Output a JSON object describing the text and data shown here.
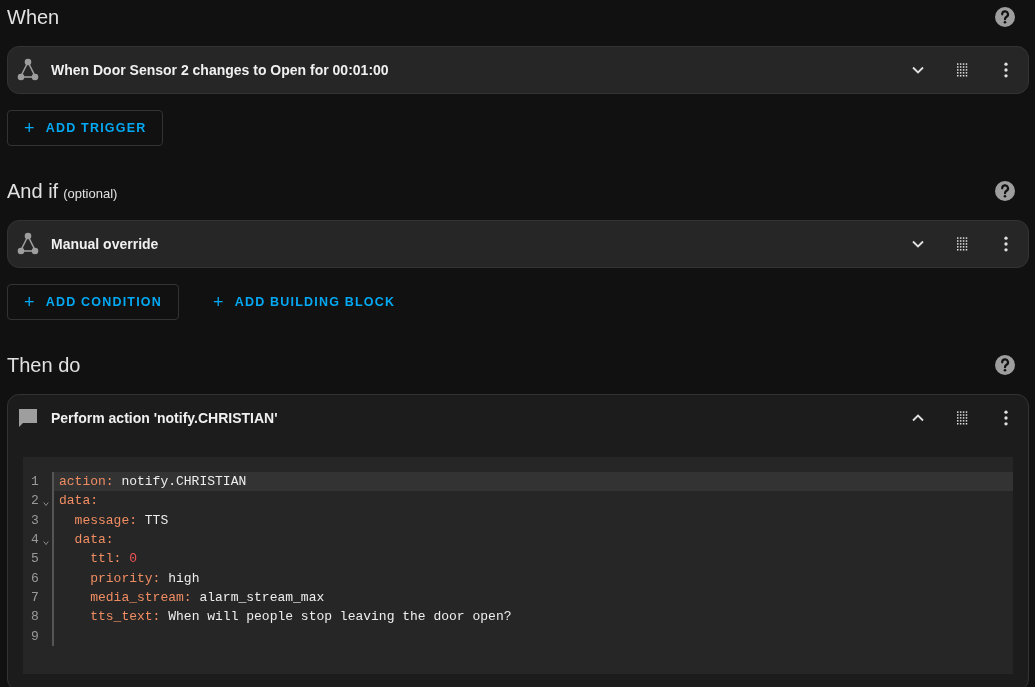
{
  "sections": [
    {
      "title": "When",
      "cards": [
        {
          "kind": "trigger",
          "label": "When Door Sensor 2 changes to Open for 00:01:00",
          "expanded": false
        }
      ],
      "buttons": [
        {
          "label": "ADD TRIGGER",
          "kind": "outlined",
          "icon": "+"
        }
      ]
    },
    {
      "title": "And if",
      "subtitle": "(optional)",
      "cards": [
        {
          "kind": "condition",
          "label": "Manual override",
          "expanded": false
        }
      ],
      "buttons": [
        {
          "label": "ADD CONDITION",
          "kind": "outlined",
          "icon": "+"
        },
        {
          "label": "ADD BUILDING BLOCK",
          "kind": "text",
          "icon": "+"
        }
      ]
    },
    {
      "title": "Then do",
      "cards": [
        {
          "kind": "action",
          "label": "Perform action 'notify.CHRISTIAN'",
          "expanded": true,
          "code": [
            {
              "number": "1",
              "key": "action:",
              "value": "notify.CHRISTIAN",
              "kind": "string",
              "foldable": false,
              "active": true
            },
            {
              "number": "2",
              "key": "data:",
              "foldable": true,
              "active": false
            },
            {
              "number": "3",
              "key": "  message:",
              "value": "TTS",
              "kind": "string",
              "foldable": false,
              "active": false
            },
            {
              "number": "4",
              "key": "  data:",
              "foldable": true,
              "active": false
            },
            {
              "number": "5",
              "key": "    ttl:",
              "value": "0",
              "kind": "number",
              "foldable": false,
              "active": false
            },
            {
              "number": "6",
              "key": "    priority:",
              "value": "high",
              "kind": "string",
              "foldable": false,
              "active": false
            },
            {
              "number": "7",
              "key": "    media_stream:",
              "value": "alarm_stream_max",
              "kind": "string",
              "foldable": false,
              "active": false
            },
            {
              "number": "8",
              "key": "    tts_text:",
              "value": "When will people stop leaving the door open?",
              "kind": "string",
              "foldable": false,
              "active": false
            },
            {
              "number": "9",
              "foldable": false,
              "active": false
            }
          ]
        }
      ]
    }
  ]
}
